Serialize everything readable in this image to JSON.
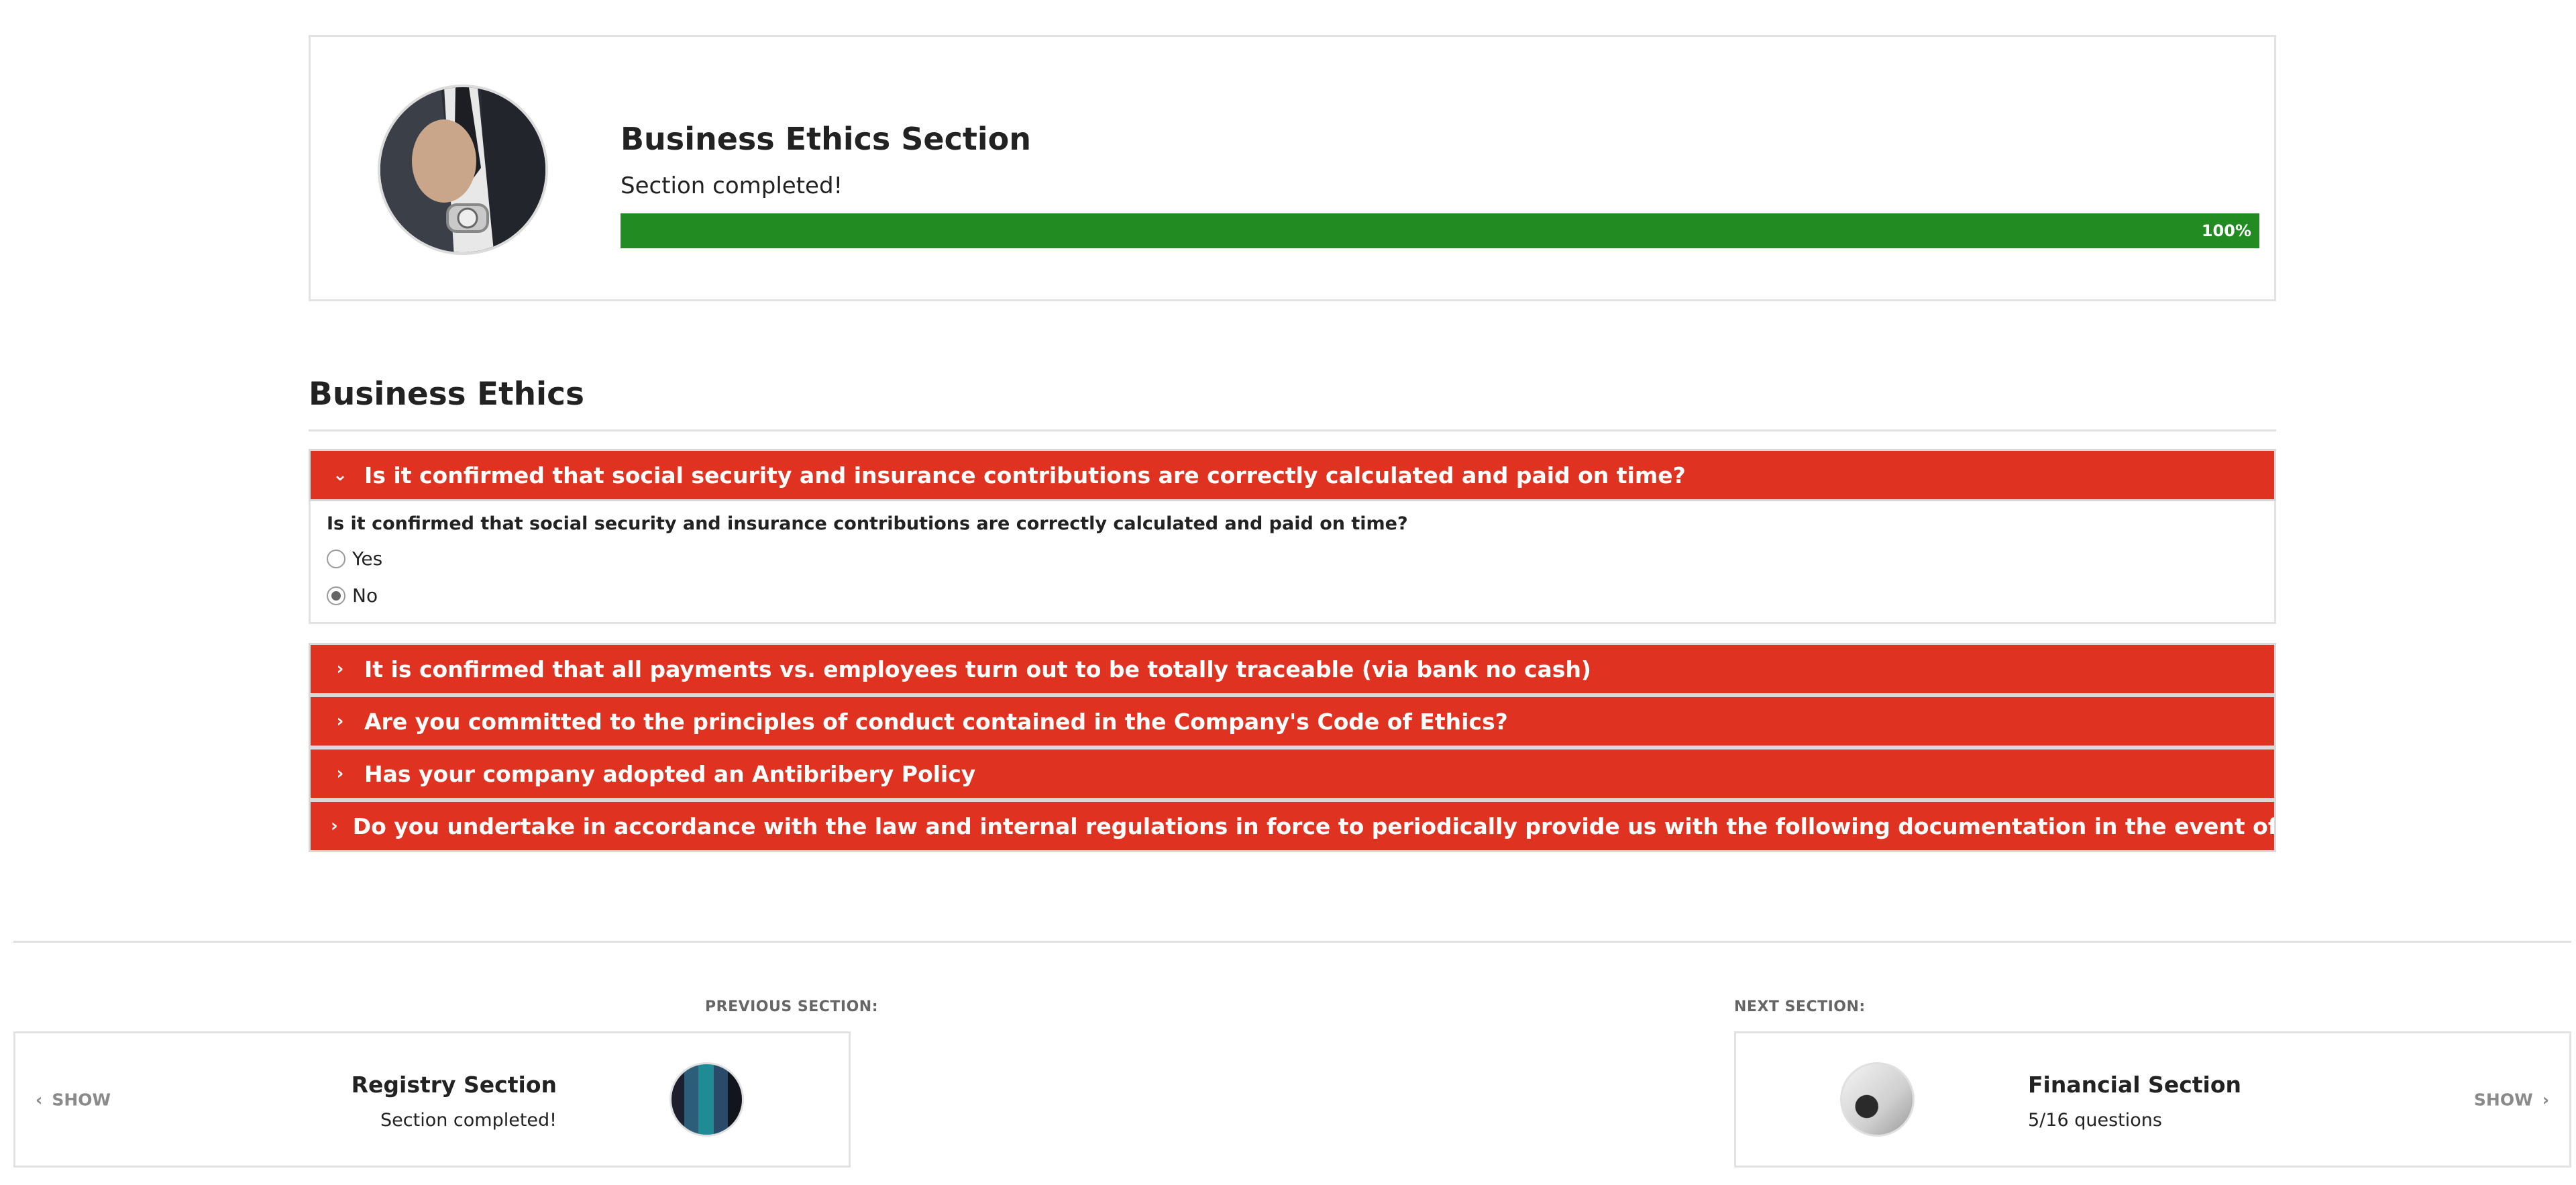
{
  "header": {
    "avatar_icon": "businessman-avatar-image",
    "title": "Business Ethics Section",
    "status": "Section completed!",
    "progress_percent": 100,
    "progress_label": "100%",
    "progress_color": "#228b22"
  },
  "section": {
    "heading": "Business Ethics"
  },
  "accordion": {
    "accent_color": "#e03220",
    "expanded": {
      "title": "Is it confirmed that social security and insurance contributions are correctly calculated and paid on time?",
      "question": "Is it confirmed that social security and insurance contributions are correctly calculated and paid on time?",
      "options": [
        {
          "label": "Yes",
          "selected": false
        },
        {
          "label": "No",
          "selected": true
        }
      ]
    },
    "collapsed": [
      {
        "title": "It is confirmed that all payments vs. employees turn out to be totally traceable (via bank no cash)"
      },
      {
        "title": "Are you committed to the principles of conduct contained in the Company's Code of Ethics?"
      },
      {
        "title": "Has your company adopted an Antibribery Policy"
      },
      {
        "title": "Do you undertake in accordance with the law and internal regulations in force to periodically provide us with the following documentation in the event of a future contracting?"
      }
    ]
  },
  "footer": {
    "previous": {
      "caption": "PREVIOUS SECTION:",
      "show_label": "SHOW",
      "title": "Registry Section",
      "status": "Section completed!",
      "thumb_icon": "binders-thumbnail"
    },
    "next": {
      "caption": "NEXT SECTION:",
      "show_label": "SHOW",
      "title": "Financial Section",
      "status": "5/16 questions",
      "thumb_icon": "finance-thumbnail"
    }
  }
}
